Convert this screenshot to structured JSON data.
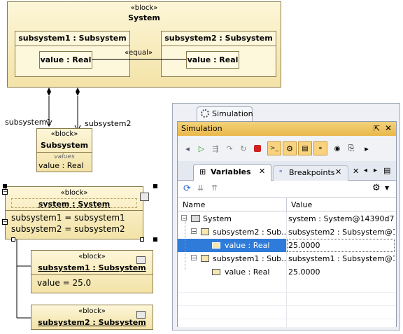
{
  "diagram": {
    "system_block": {
      "stereotype": "«block»",
      "name": "System",
      "part1": {
        "name": "subsystem1 : Subsystem",
        "value": "value : Real"
      },
      "part2": {
        "name": "subsystem2 : Subsystem",
        "value": "value : Real"
      },
      "connector_label": "«equal»"
    },
    "assoc_label_1": "subsystem1",
    "assoc_label_2": "subsystem2",
    "subsystem_block": {
      "stereotype": "«block»",
      "name": "Subsystem",
      "compartment": "values",
      "value": "value : Real"
    },
    "instance_system": {
      "stereotype": "«block»",
      "name": "system : System",
      "slot1": "subsystem1 = subsystem1",
      "slot2": "subsystem2 = subsystem2"
    },
    "instance_sub1": {
      "stereotype": "«block»",
      "name": "subsystem1 : Subsystem",
      "slot": "value = 25.0"
    },
    "instance_sub2": {
      "stereotype": "«block»",
      "name": "subsystem2 : Subsystem"
    }
  },
  "panel": {
    "outer_tab": "Simulation",
    "title": "Simulation",
    "tabs": [
      {
        "label": "Variables"
      },
      {
        "label": "Breakpoints"
      }
    ],
    "columns": [
      "Name",
      "Value"
    ],
    "rows": [
      {
        "name": "System",
        "value": "system : System@14390d7"
      },
      {
        "name": "subsystem2 : Sub...",
        "value": "subsystem2 : Subsystem@1..."
      },
      {
        "name": "value : Real",
        "value": "25.0000"
      },
      {
        "name": "subsystem1 : Sub...",
        "value": "subsystem1 : Subsystem@1..."
      },
      {
        "name": "value : Real",
        "value": "25.0000"
      }
    ]
  }
}
